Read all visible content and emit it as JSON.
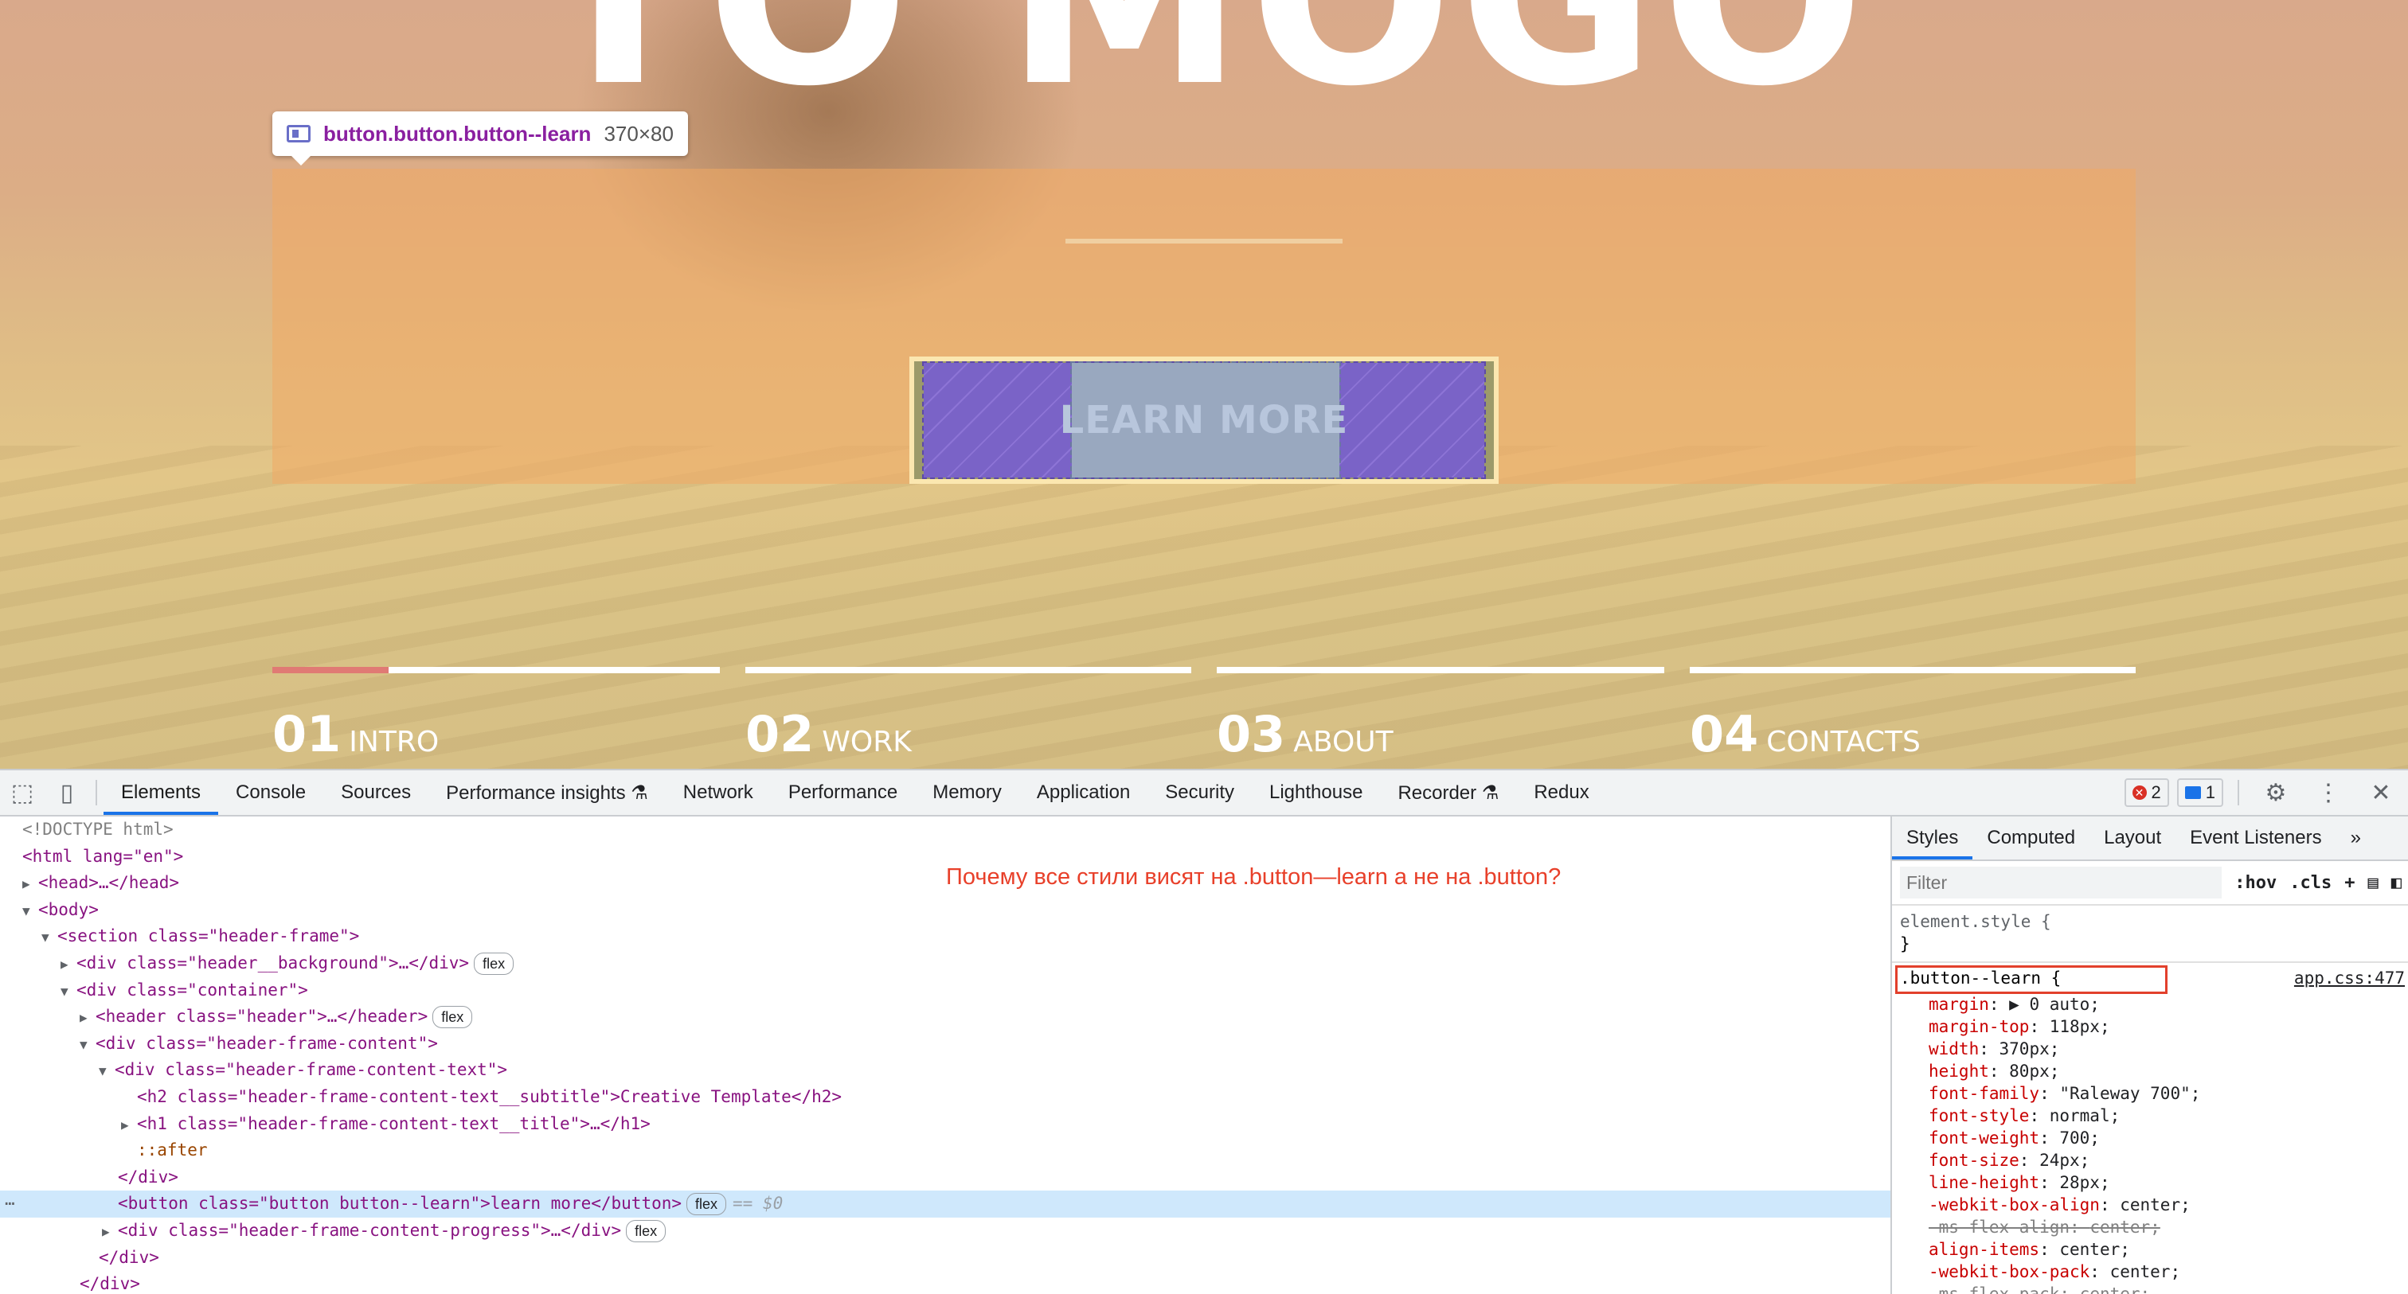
{
  "site": {
    "title": "TO MOGO",
    "button_label": "learn more",
    "tooltip": {
      "selector": "button.button.button--learn",
      "size": "370×80"
    },
    "progress_fill_fraction": 0.26,
    "nav": [
      {
        "num": "01",
        "label": "INTRO"
      },
      {
        "num": "02",
        "label": "WORK"
      },
      {
        "num": "03",
        "label": "ABOUT"
      },
      {
        "num": "04",
        "label": "CONTACTS"
      }
    ]
  },
  "devtools": {
    "tabs": [
      "Elements",
      "Console",
      "Sources",
      "Performance insights ⚗",
      "Network",
      "Performance",
      "Memory",
      "Application",
      "Security",
      "Lighthouse",
      "Recorder ⚗",
      "Redux"
    ],
    "active_tab": "Elements",
    "errors_count": "2",
    "messages_count": "1",
    "annotation": "Почему все стили висят на .button—learn а не на .button?",
    "dom": {
      "doctype": "<!DOCTYPE html>",
      "html_open": "<html lang=\"en\">",
      "head": "<head>…</head>",
      "body_open": "<body>",
      "section": "<section class=\"header-frame\">",
      "background": "<div class=\"header__background\">…</div>",
      "container": "<div class=\"container\">",
      "header": "<header class=\"header\">…</header>",
      "content": "<div class=\"header-frame-content\">",
      "content_text": "<div class=\"header-frame-content-text\">",
      "subtitle": "<h2 class=\"header-frame-content-text__subtitle\">Creative Template</h2>",
      "title": "<h1 class=\"header-frame-content-text__title\">…</h1>",
      "after": "::after",
      "div_close": "</div>",
      "button": "<button class=\"button button--learn\">learn more</button>",
      "progress": "<div class=\"header-frame-content-progress\">…</div>",
      "div_close_2": "</div>",
      "div_close_3": "</div>",
      "flex_badge": "flex",
      "eq_marker": "== $0"
    },
    "styles_tabs": [
      "Styles",
      "Computed",
      "Layout",
      "Event Listeners",
      "»"
    ],
    "filter_placeholder": "Filter",
    "hov": ":hov",
    "cls": ".cls",
    "element_style": "element.style {",
    "close_brace": "}",
    "rule_selector": ".button--learn {",
    "rule_source": "app.css:477",
    "declarations": [
      {
        "prop": "margin",
        "value": "▶ 0 auto;",
        "struck": false
      },
      {
        "prop": "margin-top",
        "value": "118px;",
        "struck": false
      },
      {
        "prop": "width",
        "value": "370px;",
        "struck": false
      },
      {
        "prop": "height",
        "value": "80px;",
        "struck": false
      },
      {
        "prop": "font-family",
        "value": "\"Raleway 700\";",
        "struck": false
      },
      {
        "prop": "font-style",
        "value": "normal;",
        "struck": false
      },
      {
        "prop": "font-weight",
        "value": "700;",
        "struck": false
      },
      {
        "prop": "font-size",
        "value": "24px;",
        "struck": false
      },
      {
        "prop": "line-height",
        "value": "28px;",
        "struck": false
      },
      {
        "prop": "-webkit-box-align",
        "value": "center;",
        "struck": false
      },
      {
        "prop": "-ms-flex-align",
        "value": "center;",
        "struck": true
      },
      {
        "prop": "align-items",
        "value": "center;",
        "struck": false
      },
      {
        "prop": "-webkit-box-pack",
        "value": "center;",
        "struck": false
      },
      {
        "prop": "-ms-flex-pack",
        "value": "center;",
        "struck": true
      }
    ]
  }
}
